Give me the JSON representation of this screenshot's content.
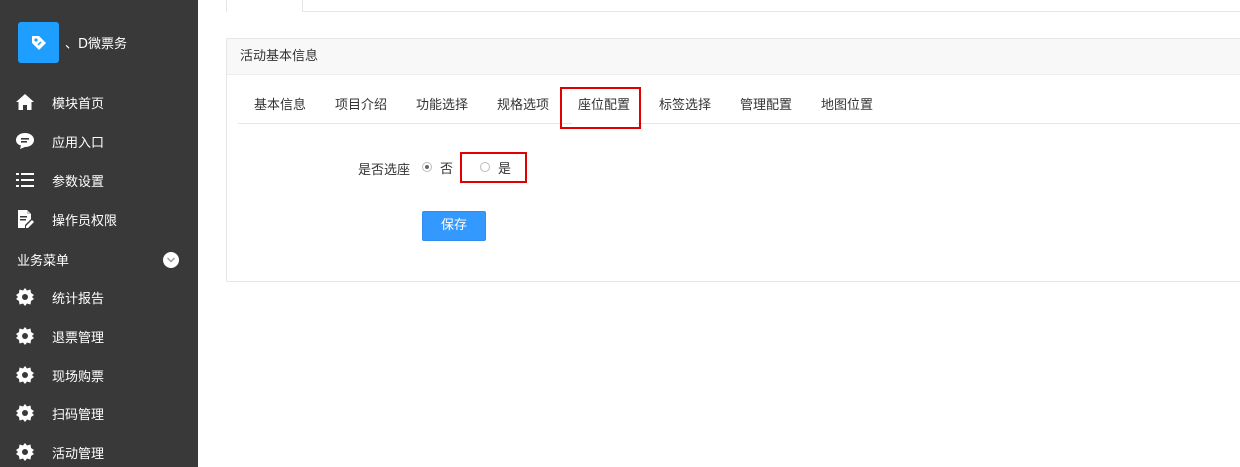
{
  "brand": {
    "title": "、D微票务"
  },
  "sidebar": {
    "items": [
      {
        "label": "模块首页",
        "icon": "home-icon"
      },
      {
        "label": "应用入口",
        "icon": "chat-bubble-icon"
      },
      {
        "label": "参数设置",
        "icon": "list-icon"
      },
      {
        "label": "操作员权限",
        "icon": "edit-document-icon"
      }
    ],
    "section": {
      "label": "业务菜单",
      "icon": "chevron-down-icon"
    },
    "section_items": [
      {
        "label": "统计报告",
        "icon": "gear-icon"
      },
      {
        "label": "退票管理",
        "icon": "gear-icon"
      },
      {
        "label": "现场购票",
        "icon": "gear-icon"
      },
      {
        "label": "扫码管理",
        "icon": "gear-icon"
      },
      {
        "label": "活动管理",
        "icon": "gear-icon"
      }
    ]
  },
  "panel": {
    "title": "活动基本信息",
    "tabs": [
      {
        "label": "基本信息"
      },
      {
        "label": "项目介绍"
      },
      {
        "label": "功能选择"
      },
      {
        "label": "规格选项"
      },
      {
        "label": "座位配置",
        "active": true
      },
      {
        "label": "标签选择"
      },
      {
        "label": "管理配置"
      },
      {
        "label": "地图位置"
      }
    ]
  },
  "form": {
    "seat_label": "是否选座",
    "options": [
      {
        "label": "否",
        "checked": true
      },
      {
        "label": "是",
        "checked": false
      }
    ],
    "save_label": "保存"
  },
  "colors": {
    "sidebar_bg": "#393939",
    "accent": "#1e9fff",
    "button": "#3399ff",
    "highlight": "#e00000"
  }
}
